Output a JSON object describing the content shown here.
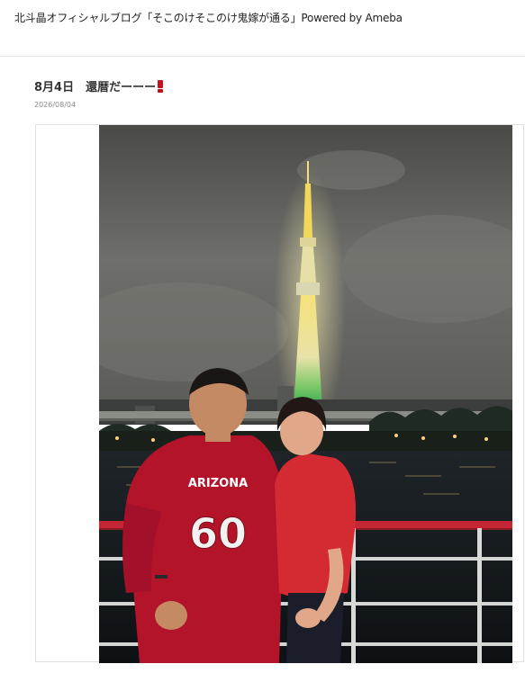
{
  "header": {
    "site_title": "北斗晶オフィシャルブログ「そこのけそこのけ鬼嫁が通る」Powered by Ameba"
  },
  "entry": {
    "title": "8月4日　還暦だーーー",
    "title_icon": "red-exclamation-icon",
    "date": "2026/08/04"
  },
  "photo": {
    "jersey_text": "ARIZONA",
    "jersey_number": "60"
  },
  "colors": {
    "accent_red": "#c1121f",
    "jersey_red": "#b3142a",
    "night_sky": "#5b5b58"
  }
}
